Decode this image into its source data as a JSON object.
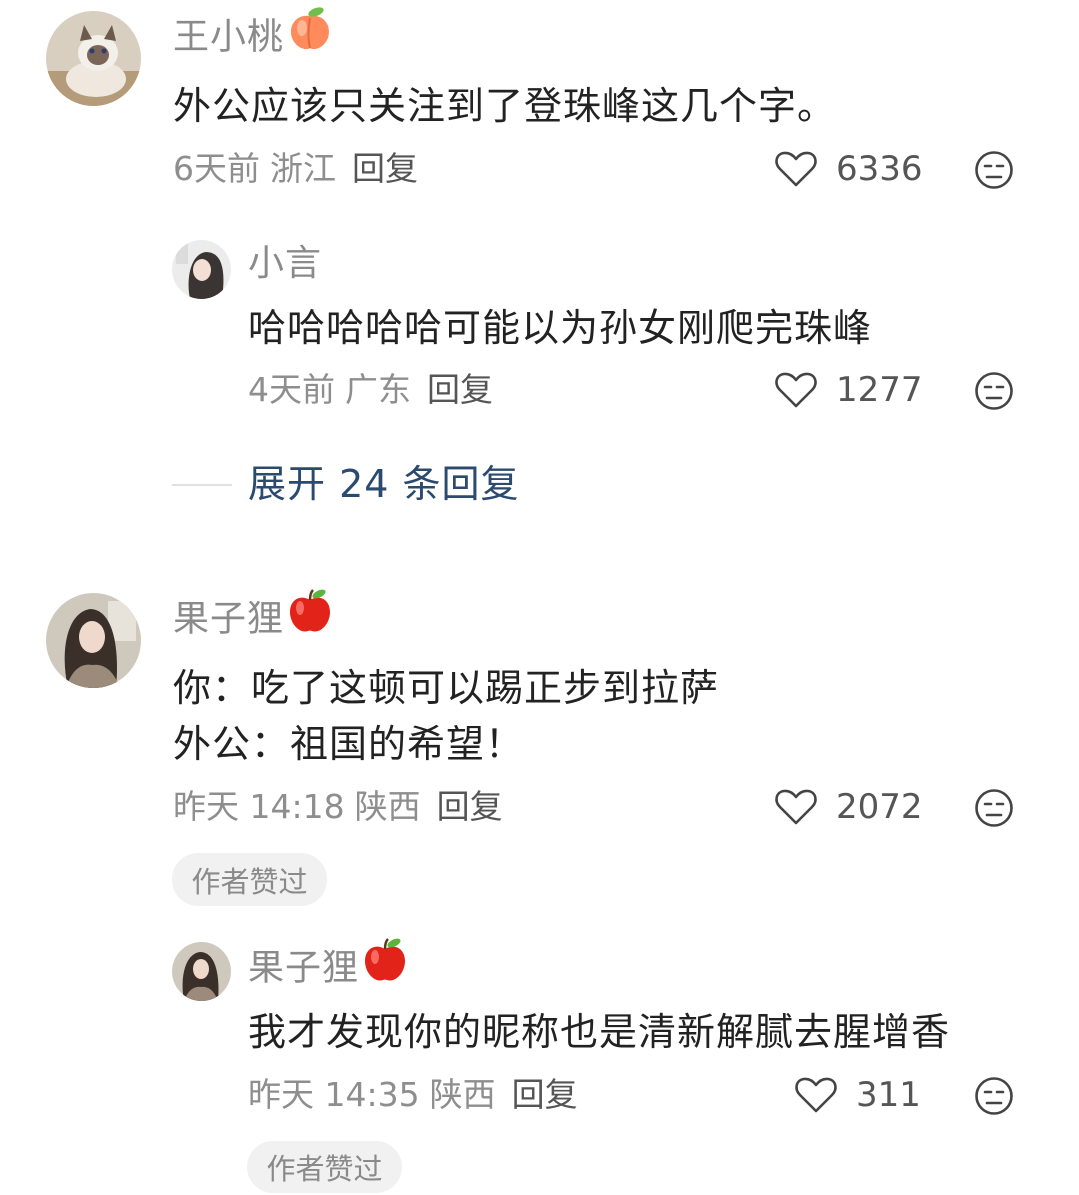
{
  "comments": [
    {
      "username": "王小桃",
      "emoji": "peach-emoji",
      "text": "外公应该只关注到了登珠峰这几个字。",
      "time": "6天前",
      "location": "浙江",
      "reply_label": "回复",
      "likes": "6336"
    },
    {
      "username": "小言",
      "text": "哈哈哈哈哈可能以为孙女刚爬完珠峰",
      "time": "4天前",
      "location": "广东",
      "reply_label": "回复",
      "likes": "1277"
    },
    {
      "username": "果子狸",
      "emoji": "apple-emoji",
      "text_lines": [
        "你：吃了这顿可以踢正步到拉萨",
        "外公：祖国的希望！"
      ],
      "time": "昨天 14:18",
      "location": "陕西",
      "reply_label": "回复",
      "likes": "2072",
      "badge": "作者赞过"
    },
    {
      "username": "果子狸",
      "emoji": "apple-emoji",
      "text": "我才发现你的昵称也是清新解腻去腥增香",
      "time": "昨天 14:35",
      "location": "陕西",
      "reply_label": "回复",
      "likes": "311",
      "badge": "作者赞过"
    }
  ],
  "expand_replies": "展开 24 条回复",
  "colors": {
    "username": "#8a8a8a",
    "text": "#222222",
    "meta": "#8e8e8e",
    "expand": "#2b4a70",
    "badge_bg": "#f1f1f1"
  }
}
